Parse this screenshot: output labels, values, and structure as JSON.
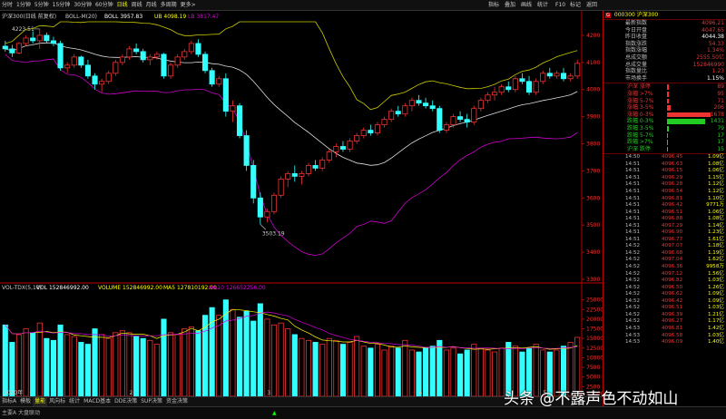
{
  "toolbar": {
    "periods": [
      "分时",
      "1分钟",
      "5分钟",
      "15分钟",
      "30分钟",
      "60分钟",
      "日线",
      "周线",
      "月线",
      "多周期",
      "更多>"
    ],
    "active_period": "日线",
    "right_items": [
      "指标",
      "叠加",
      "画线",
      "统计",
      "F10",
      "标记",
      "返回"
    ]
  },
  "kline": {
    "title": "沪深300(日线 前复权)",
    "boll_label": "BOLL-M(20)",
    "boll_boll": "BOLL 3957.83",
    "boll_ub": "UB 4098.19",
    "boll_lb": "LB 3817.47",
    "high_mark": "4223.51",
    "low_mark": "3503.19",
    "yaxis": [
      "4200",
      "4100",
      "4000",
      "3900",
      "3800",
      "3700",
      "3600",
      "3500",
      "3400",
      "3300"
    ]
  },
  "volume": {
    "title": "VOL-TDX(5,10)",
    "vol": "VOL 152846992.00",
    "volume": "VOLUME 152846992.00",
    "ma5": "MA5 127810192.00",
    "ma10": "MA10 126652256.00",
    "yaxis": [
      "25000",
      "22500",
      "20000",
      "17500",
      "15000",
      "12500",
      "10000",
      "7500",
      "5000",
      "2500"
    ],
    "unit": "X10000",
    "date_label": "2020年",
    "month_marks": [
      "2",
      "3",
      "4",
      "5"
    ]
  },
  "chart_data": {
    "type": "candlestick",
    "title": "沪深300(日线 前复权)",
    "indicators": [
      "BOLL-M(20)",
      "VOL-TDX(5,10)"
    ],
    "ylim": [
      3300,
      4250
    ],
    "vol_ylim": [
      0,
      27500
    ],
    "ohlc": [
      [
        4160,
        4180,
        4140,
        4150
      ],
      [
        4150,
        4165,
        4120,
        4135
      ],
      [
        4135,
        4175,
        4130,
        4170
      ],
      [
        4170,
        4200,
        4160,
        4190
      ],
      [
        4190,
        4215,
        4170,
        4180
      ],
      [
        4180,
        4223.51,
        4150,
        4200
      ],
      [
        4200,
        4210,
        4170,
        4180
      ],
      [
        4180,
        4195,
        4160,
        4170
      ],
      [
        4170,
        4180,
        4070,
        4080
      ],
      [
        4080,
        4100,
        4060,
        4090
      ],
      [
        4090,
        4130,
        4080,
        4120
      ],
      [
        4120,
        4125,
        4080,
        4090
      ],
      [
        4090,
        4110,
        4040,
        4050
      ],
      [
        4050,
        4060,
        4000,
        4020
      ],
      [
        4020,
        4040,
        3990,
        4030
      ],
      [
        4030,
        4070,
        4020,
        4060
      ],
      [
        4060,
        4110,
        4050,
        4100
      ],
      [
        4100,
        4130,
        4090,
        4120
      ],
      [
        4120,
        4160,
        4110,
        4150
      ],
      [
        4150,
        4170,
        4130,
        4140
      ],
      [
        4140,
        4150,
        4100,
        4110
      ],
      [
        4110,
        4130,
        4090,
        4120
      ],
      [
        4120,
        4140,
        4110,
        4130
      ],
      [
        4130,
        4135,
        4040,
        4050
      ],
      [
        4050,
        4100,
        4040,
        4090
      ],
      [
        4090,
        4130,
        4080,
        4120
      ],
      [
        4120,
        4150,
        4110,
        4140
      ],
      [
        4140,
        4180,
        4130,
        4170
      ],
      [
        4170,
        4185,
        4120,
        4130
      ],
      [
        4130,
        4140,
        4060,
        4070
      ],
      [
        4070,
        4080,
        4010,
        4020
      ],
      [
        4020,
        4050,
        4010,
        4040
      ],
      [
        4040,
        4060,
        3900,
        3920
      ],
      [
        3920,
        3960,
        3880,
        3940
      ],
      [
        3940,
        3950,
        3820,
        3830
      ],
      [
        3830,
        3850,
        3700,
        3720
      ],
      [
        3720,
        3740,
        3580,
        3600
      ],
      [
        3600,
        3620,
        3503.19,
        3530
      ],
      [
        3530,
        3560,
        3510,
        3550
      ],
      [
        3550,
        3620,
        3540,
        3610
      ],
      [
        3610,
        3680,
        3600,
        3670
      ],
      [
        3670,
        3700,
        3640,
        3690
      ],
      [
        3690,
        3720,
        3660,
        3680
      ],
      [
        3680,
        3700,
        3650,
        3690
      ],
      [
        3690,
        3730,
        3680,
        3720
      ],
      [
        3720,
        3740,
        3700,
        3710
      ],
      [
        3710,
        3750,
        3700,
        3740
      ],
      [
        3740,
        3780,
        3730,
        3770
      ],
      [
        3770,
        3800,
        3750,
        3790
      ],
      [
        3790,
        3810,
        3770,
        3780
      ],
      [
        3780,
        3820,
        3770,
        3810
      ],
      [
        3810,
        3840,
        3800,
        3830
      ],
      [
        3830,
        3860,
        3820,
        3850
      ],
      [
        3850,
        3870,
        3830,
        3840
      ],
      [
        3840,
        3880,
        3830,
        3870
      ],
      [
        3870,
        3900,
        3860,
        3890
      ],
      [
        3890,
        3930,
        3880,
        3920
      ],
      [
        3920,
        3940,
        3900,
        3910
      ],
      [
        3910,
        3950,
        3900,
        3940
      ],
      [
        3940,
        3970,
        3920,
        3960
      ],
      [
        3960,
        3980,
        3940,
        3950
      ],
      [
        3950,
        3970,
        3930,
        3940
      ],
      [
        3940,
        3960,
        3920,
        3930
      ],
      [
        3930,
        3940,
        3840,
        3850
      ],
      [
        3850,
        3880,
        3840,
        3870
      ],
      [
        3870,
        3910,
        3860,
        3900
      ],
      [
        3900,
        3920,
        3880,
        3890
      ],
      [
        3890,
        3910,
        3860,
        3880
      ],
      [
        3880,
        3940,
        3870,
        3930
      ],
      [
        3930,
        3970,
        3920,
        3960
      ],
      [
        3960,
        3990,
        3950,
        3980
      ],
      [
        3980,
        4010,
        3960,
        3990
      ],
      [
        3990,
        4020,
        3980,
        4010
      ],
      [
        4010,
        4030,
        3990,
        4000
      ],
      [
        4000,
        4050,
        3990,
        4040
      ],
      [
        4040,
        4060,
        4020,
        4030
      ],
      [
        4030,
        4050,
        3980,
        3990
      ],
      [
        3990,
        4040,
        3980,
        4030
      ],
      [
        4030,
        4070,
        4020,
        4060
      ],
      [
        4060,
        4080,
        4040,
        4050
      ],
      [
        4050,
        4070,
        4040,
        4060
      ],
      [
        4060,
        4080,
        4030,
        4040
      ],
      [
        4040,
        4060,
        4030,
        4050
      ],
      [
        4050,
        4110,
        4040,
        4096.45
      ]
    ],
    "volume_values": [
      18500,
      14000,
      16000,
      17500,
      16500,
      19000,
      15000,
      14500,
      18500,
      16000,
      15500,
      14000,
      13500,
      17500,
      16000,
      15000,
      16500,
      17000,
      16500,
      15500,
      15000,
      14500,
      13500,
      20000,
      16500,
      16000,
      17500,
      18000,
      17000,
      21000,
      23000,
      21000,
      25000,
      22500,
      20500,
      22000,
      19500,
      24000,
      20000,
      18500,
      19000,
      17500,
      16000,
      15000,
      14500,
      14000,
      13500,
      15000,
      14500,
      13500,
      14000,
      15500,
      13000,
      12500,
      13500,
      12000,
      13000,
      12500,
      14500,
      12000,
      11500,
      12500,
      13000,
      14500,
      12000,
      12500,
      11000,
      12000,
      13500,
      12500,
      12000,
      11500,
      12500,
      14000,
      13000,
      11500,
      12500,
      13500,
      12000,
      11500,
      12000,
      13000,
      14000,
      15285
    ]
  },
  "panel": {
    "index_code": "000300",
    "index_name": "沪深300",
    "stats": [
      {
        "label": "最新指数",
        "value": "4096.21",
        "white": false
      },
      {
        "label": "今日开盘",
        "value": "4047.65",
        "white": false
      },
      {
        "label": "昨日收盘",
        "value": "4044.38",
        "white": true
      },
      {
        "label": "指数涨跌",
        "value": "54.33",
        "white": false
      },
      {
        "label": "指数涨幅",
        "value": "1.34%",
        "white": false
      },
      {
        "label": "总成交额",
        "value": "2555.50亿",
        "white": false
      },
      {
        "label": "总成交量",
        "value": "152846990",
        "white": false
      },
      {
        "label": "指数量比",
        "value": "1.23",
        "white": false
      },
      {
        "label": "市场换手",
        "value": "1.15%",
        "white": true
      }
    ],
    "breadth": [
      {
        "label": "沪深 涨停",
        "value": "89",
        "color": "#e33",
        "barw": 2
      },
      {
        "label": "涨幅 >7%",
        "value": "95",
        "color": "#e33",
        "barw": 2
      },
      {
        "label": "涨幅 5-7%",
        "value": "71",
        "color": "#e33",
        "barw": 2
      },
      {
        "label": "涨幅 3-5%",
        "value": "206",
        "color": "#e33",
        "barw": 4
      },
      {
        "label": "涨幅 0-3%",
        "value": "1678",
        "color": "#e33",
        "barw": 48
      },
      {
        "label": "跌幅 0-3%",
        "value": "1431",
        "color": "#2c2",
        "barw": 42
      },
      {
        "label": "跌幅 3-5%",
        "value": "79",
        "color": "#2c2",
        "barw": 2
      },
      {
        "label": "跌幅 5-7%",
        "value": "17",
        "color": "#2c2",
        "barw": 1
      },
      {
        "label": "跌幅 >7%",
        "value": "17",
        "color": "#2c2",
        "barw": 1
      },
      {
        "label": "沪深 跌停",
        "value": "15",
        "color": "#2c2",
        "barw": 1
      }
    ],
    "ticks": [
      {
        "t": "14:50",
        "p": "4096.45",
        "v": "1.09亿"
      },
      {
        "t": "14:51",
        "p": "4096.63",
        "v": "1.08亿"
      },
      {
        "t": "14:51",
        "p": "4096.15",
        "v": "1.06亿"
      },
      {
        "t": "14:51",
        "p": "4096.29",
        "v": "1.15亿"
      },
      {
        "t": "14:51",
        "p": "4096.28",
        "v": "1.12亿"
      },
      {
        "t": "14:51",
        "p": "4096.54",
        "v": "1.12亿"
      },
      {
        "t": "14:51",
        "p": "4096.81",
        "v": "1.10亿"
      },
      {
        "t": "14:51",
        "p": "4096.42",
        "v": "9771万"
      },
      {
        "t": "14:51",
        "p": "4096.51",
        "v": "1.06亿"
      },
      {
        "t": "14:51",
        "p": "4096.88",
        "v": "1.08亿"
      },
      {
        "t": "14:51",
        "p": "4097.29",
        "v": "1.14亿"
      },
      {
        "t": "14:51",
        "p": "4096.90",
        "v": "1.23亿"
      },
      {
        "t": "14:51",
        "p": "4096.77",
        "v": "1.61亿"
      },
      {
        "t": "14:52",
        "p": "4097.07",
        "v": "1.18亿"
      },
      {
        "t": "14:52",
        "p": "4096.68",
        "v": "1.19亿"
      },
      {
        "t": "14:52",
        "p": "4097.04",
        "v": "1.62亿"
      },
      {
        "t": "14:52",
        "p": "4096.36",
        "v": "9958万"
      },
      {
        "t": "14:52",
        "p": "4097.12",
        "v": "1.56亿"
      },
      {
        "t": "14:52",
        "p": "4096.82",
        "v": "1.03亿"
      },
      {
        "t": "14:52",
        "p": "4096.50",
        "v": "1.26亿"
      },
      {
        "t": "14:52",
        "p": "4096.62",
        "v": "1.09亿"
      },
      {
        "t": "14:52",
        "p": "4096.42",
        "v": "1.09亿"
      },
      {
        "t": "14:52",
        "p": "4096.51",
        "v": "1.03亿"
      },
      {
        "t": "14:52",
        "p": "4096.39",
        "v": "1.21亿"
      },
      {
        "t": "14:52",
        "p": "4096.27",
        "v": "1.17亿"
      },
      {
        "t": "14:53",
        "p": "4096.81",
        "v": "1.42亿"
      },
      {
        "t": "14:53",
        "p": "4096.58",
        "v": "1.03亿"
      },
      {
        "t": "14:53",
        "p": "4096.09",
        "v": "1.40亿"
      }
    ]
  },
  "tabs": [
    "指标A",
    "模板",
    "量能",
    "风向标",
    "统计",
    "MACD基本",
    "DDE决策",
    "SUP决策",
    "资金决策"
  ],
  "active_tab": "量能",
  "status": {
    "left": "主要A 大盘联动",
    "mid": "▲"
  },
  "watermark": "头条 @不露声色不动如山"
}
